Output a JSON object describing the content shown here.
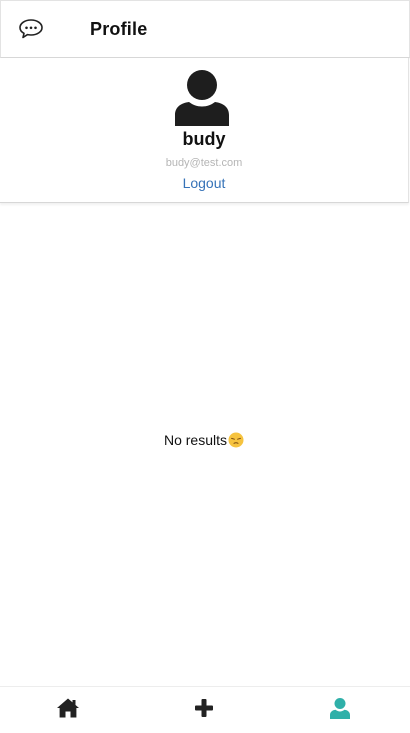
{
  "header": {
    "title": "Profile"
  },
  "profile": {
    "username": "budy",
    "email": "budy@test.com",
    "logout_label": "Logout"
  },
  "content": {
    "empty_text": "No results"
  },
  "nav": {
    "items": [
      {
        "icon": "home-icon",
        "active": false
      },
      {
        "icon": "plus-icon",
        "active": false
      },
      {
        "icon": "user-icon",
        "active": true
      }
    ],
    "active_color": "#2fb0a9",
    "inactive_color": "#222222"
  },
  "colors": {
    "link": "#3673b8",
    "muted": "#b5b5b5"
  }
}
